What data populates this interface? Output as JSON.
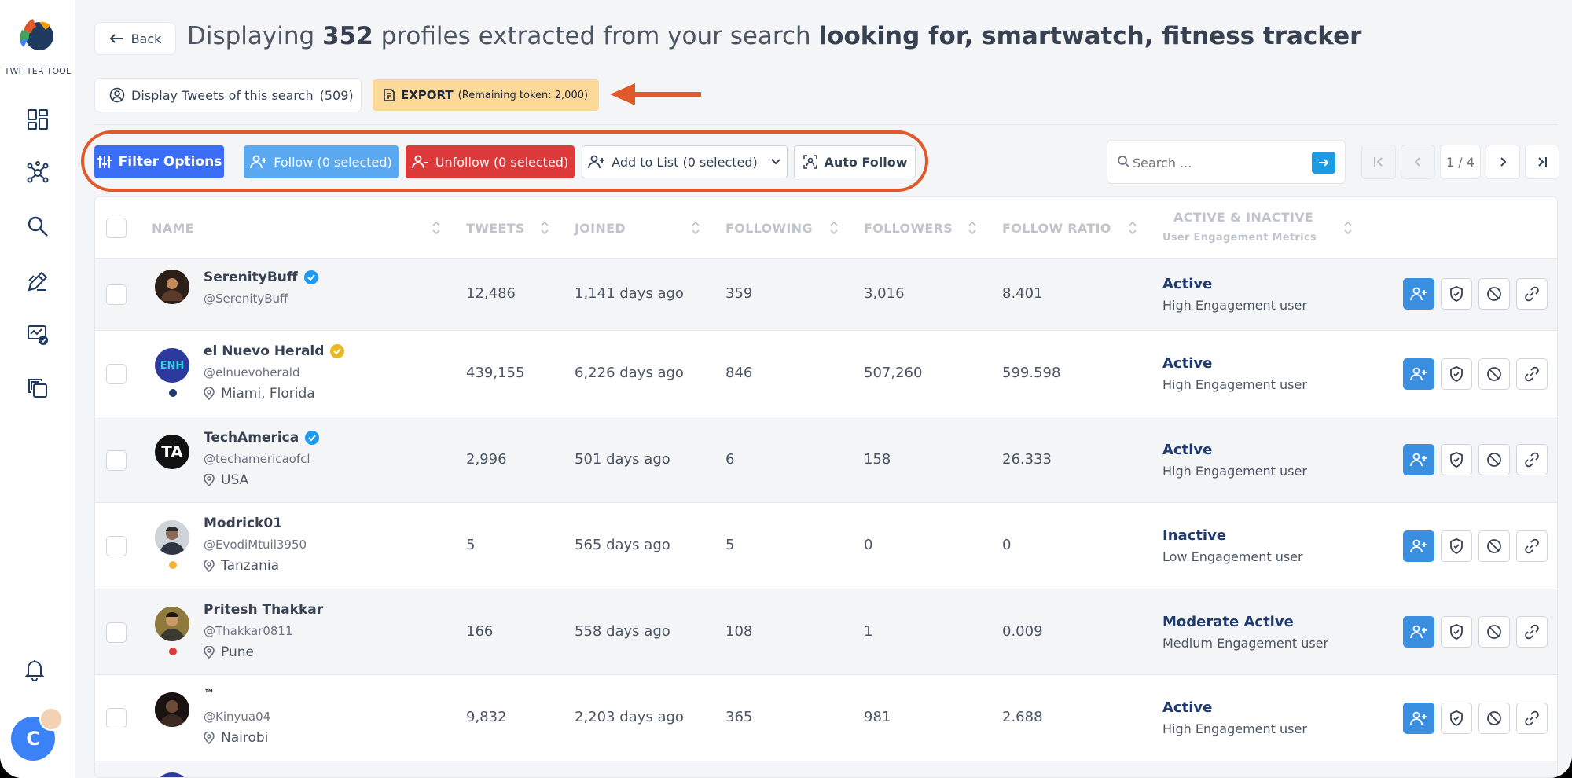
{
  "sidebar": {
    "logo_text": "TWITTER TOOL",
    "nav": [
      "dashboard-icon",
      "network-icon",
      "search-icon",
      "edit-icon",
      "analytics-icon",
      "copy-icon"
    ],
    "bell": "bell-icon",
    "avatar_letter": "C"
  },
  "header": {
    "back_label": "Back",
    "title_prefix": "Displaying",
    "count": "352",
    "title_mid": "profiles extracted from your search",
    "query": "looking for, smartwatch, fitness tracker"
  },
  "actions": {
    "tweets_label": "Display Tweets of this search",
    "tweets_count": "(509)",
    "export_label": "EXPORT",
    "export_remaining": "(Remaining token: 2,000)"
  },
  "toolbar": {
    "filter": "Filter Options",
    "follow": "Follow (0 selected)",
    "unfollow": "Unfollow (0 selected)",
    "add_list": "Add to List (0 selected)",
    "auto_follow": "Auto Follow"
  },
  "search": {
    "placeholder": "Search ..."
  },
  "pagination": {
    "page": "1 / 4"
  },
  "columns": {
    "name": "NAME",
    "tweets": "TWEETS",
    "joined": "JOINED",
    "following": "FOLLOWING",
    "followers": "FOLLOWERS",
    "ratio": "FOLLOW RATIO",
    "active": "ACTIVE & INACTIVE",
    "active_sub": "User Engagement Metrics"
  },
  "rows": [
    {
      "name": "SerenityBuff",
      "verified": "blue",
      "handle": "@SerenityBuff",
      "location": "",
      "tweets": "12,486",
      "joined": "1,141 days ago",
      "following": "359",
      "followers": "3,016",
      "ratio": "8.401",
      "status": "Active",
      "engagement": "High Engagement user"
    },
    {
      "name": "el Nuevo Herald",
      "verified": "gold",
      "handle": "@elnuevoherald",
      "location": "Miami, Florida",
      "tweets": "439,155",
      "joined": "6,226 days ago",
      "following": "846",
      "followers": "507,260",
      "ratio": "599.598",
      "status": "Active",
      "engagement": "High Engagement user"
    },
    {
      "name": "TechAmerica",
      "verified": "blue",
      "handle": "@techamericaofcl",
      "location": "USA",
      "tweets": "2,996",
      "joined": "501 days ago",
      "following": "6",
      "followers": "158",
      "ratio": "26.333",
      "status": "Active",
      "engagement": "High Engagement user"
    },
    {
      "name": "Modrick01",
      "verified": "",
      "handle": "@EvodiMtuil3950",
      "location": "Tanzania",
      "tweets": "5",
      "joined": "565 days ago",
      "following": "5",
      "followers": "0",
      "ratio": "0",
      "status": "Inactive",
      "engagement": "Low Engagement user"
    },
    {
      "name": "Pritesh Thakkar",
      "verified": "",
      "handle": "@Thakkar0811",
      "location": "Pune",
      "tweets": "166",
      "joined": "558 days ago",
      "following": "108",
      "followers": "1",
      "ratio": "0.009",
      "status": "Moderate Active",
      "engagement": "Medium Engagement user"
    },
    {
      "name": "™",
      "verified": "",
      "handle": "@Kinyua04",
      "location": "Nairobi",
      "tweets": "9,832",
      "joined": "2,203 days ago",
      "following": "365",
      "followers": "981",
      "ratio": "2.688",
      "status": "Active",
      "engagement": "High Engagement user"
    }
  ],
  "avatar_initials": {
    "row1": "ENH",
    "row2": "TA"
  },
  "colors": {
    "primary": "#3b6ef6",
    "follow": "#5aa9f0",
    "unfollow": "#dc3a3a",
    "export": "#fcd999",
    "annotation": "#e0592a",
    "status": "#1e3a6e"
  }
}
